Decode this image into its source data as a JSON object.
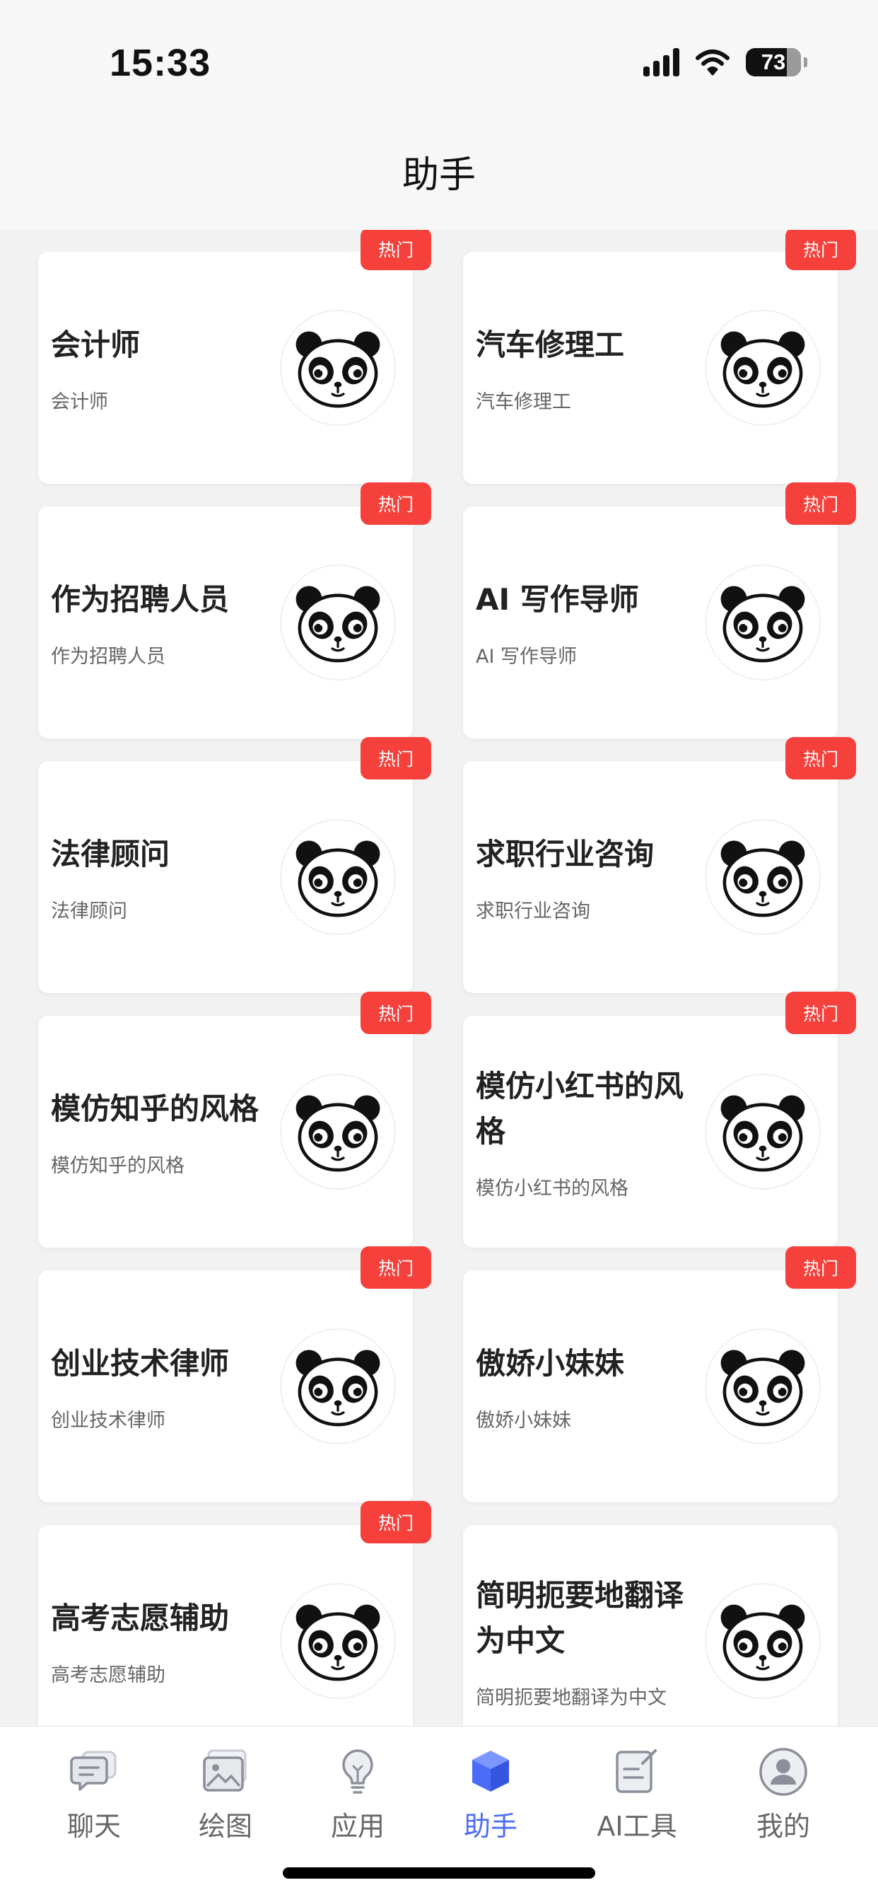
{
  "status_bar": {
    "time": "15:33",
    "battery": "73"
  },
  "header": {
    "title": "助手"
  },
  "assistants": [
    {
      "title": "会计师",
      "desc": "会计师",
      "badge": "热门"
    },
    {
      "title": "汽车修理工",
      "desc": "汽车修理工",
      "badge": "热门"
    },
    {
      "title": "作为招聘人员",
      "desc": "作为招聘人员",
      "badge": "热门"
    },
    {
      "title": "AI 写作导师",
      "desc": "AI 写作导师",
      "badge": "热门"
    },
    {
      "title": "法律顾问",
      "desc": "法律顾问",
      "badge": "热门"
    },
    {
      "title": "求职行业咨询",
      "desc": "求职行业咨询",
      "badge": "热门"
    },
    {
      "title": "模仿知乎的风格",
      "desc": "模仿知乎的风格",
      "badge": "热门"
    },
    {
      "title": "模仿小红书的风格",
      "desc": "模仿小红书的风格",
      "badge": "热门"
    },
    {
      "title": "创业技术律师",
      "desc": "创业技术律师",
      "badge": "热门"
    },
    {
      "title": "傲娇小妹妹",
      "desc": "傲娇小妹妹",
      "badge": "热门"
    },
    {
      "title": "高考志愿辅助",
      "desc": "高考志愿辅助",
      "badge": "热门"
    },
    {
      "title": "简明扼要地翻译为中文",
      "desc": "简明扼要地翻译为中文",
      "badge": ""
    }
  ],
  "avatar_icon": "panda-icon",
  "tab_bar": {
    "active_color": "#4a6cf7",
    "tabs": [
      {
        "label": "聊天",
        "icon": "chat-icon",
        "active": false
      },
      {
        "label": "绘图",
        "icon": "image-icon",
        "active": false
      },
      {
        "label": "应用",
        "icon": "lightbulb-icon",
        "active": false
      },
      {
        "label": "助手",
        "icon": "cube-icon",
        "active": true
      },
      {
        "label": "AI工具",
        "icon": "edit-note-icon",
        "active": false
      },
      {
        "label": "我的",
        "icon": "user-icon",
        "active": false
      }
    ]
  },
  "badge_color": "#f5403b"
}
